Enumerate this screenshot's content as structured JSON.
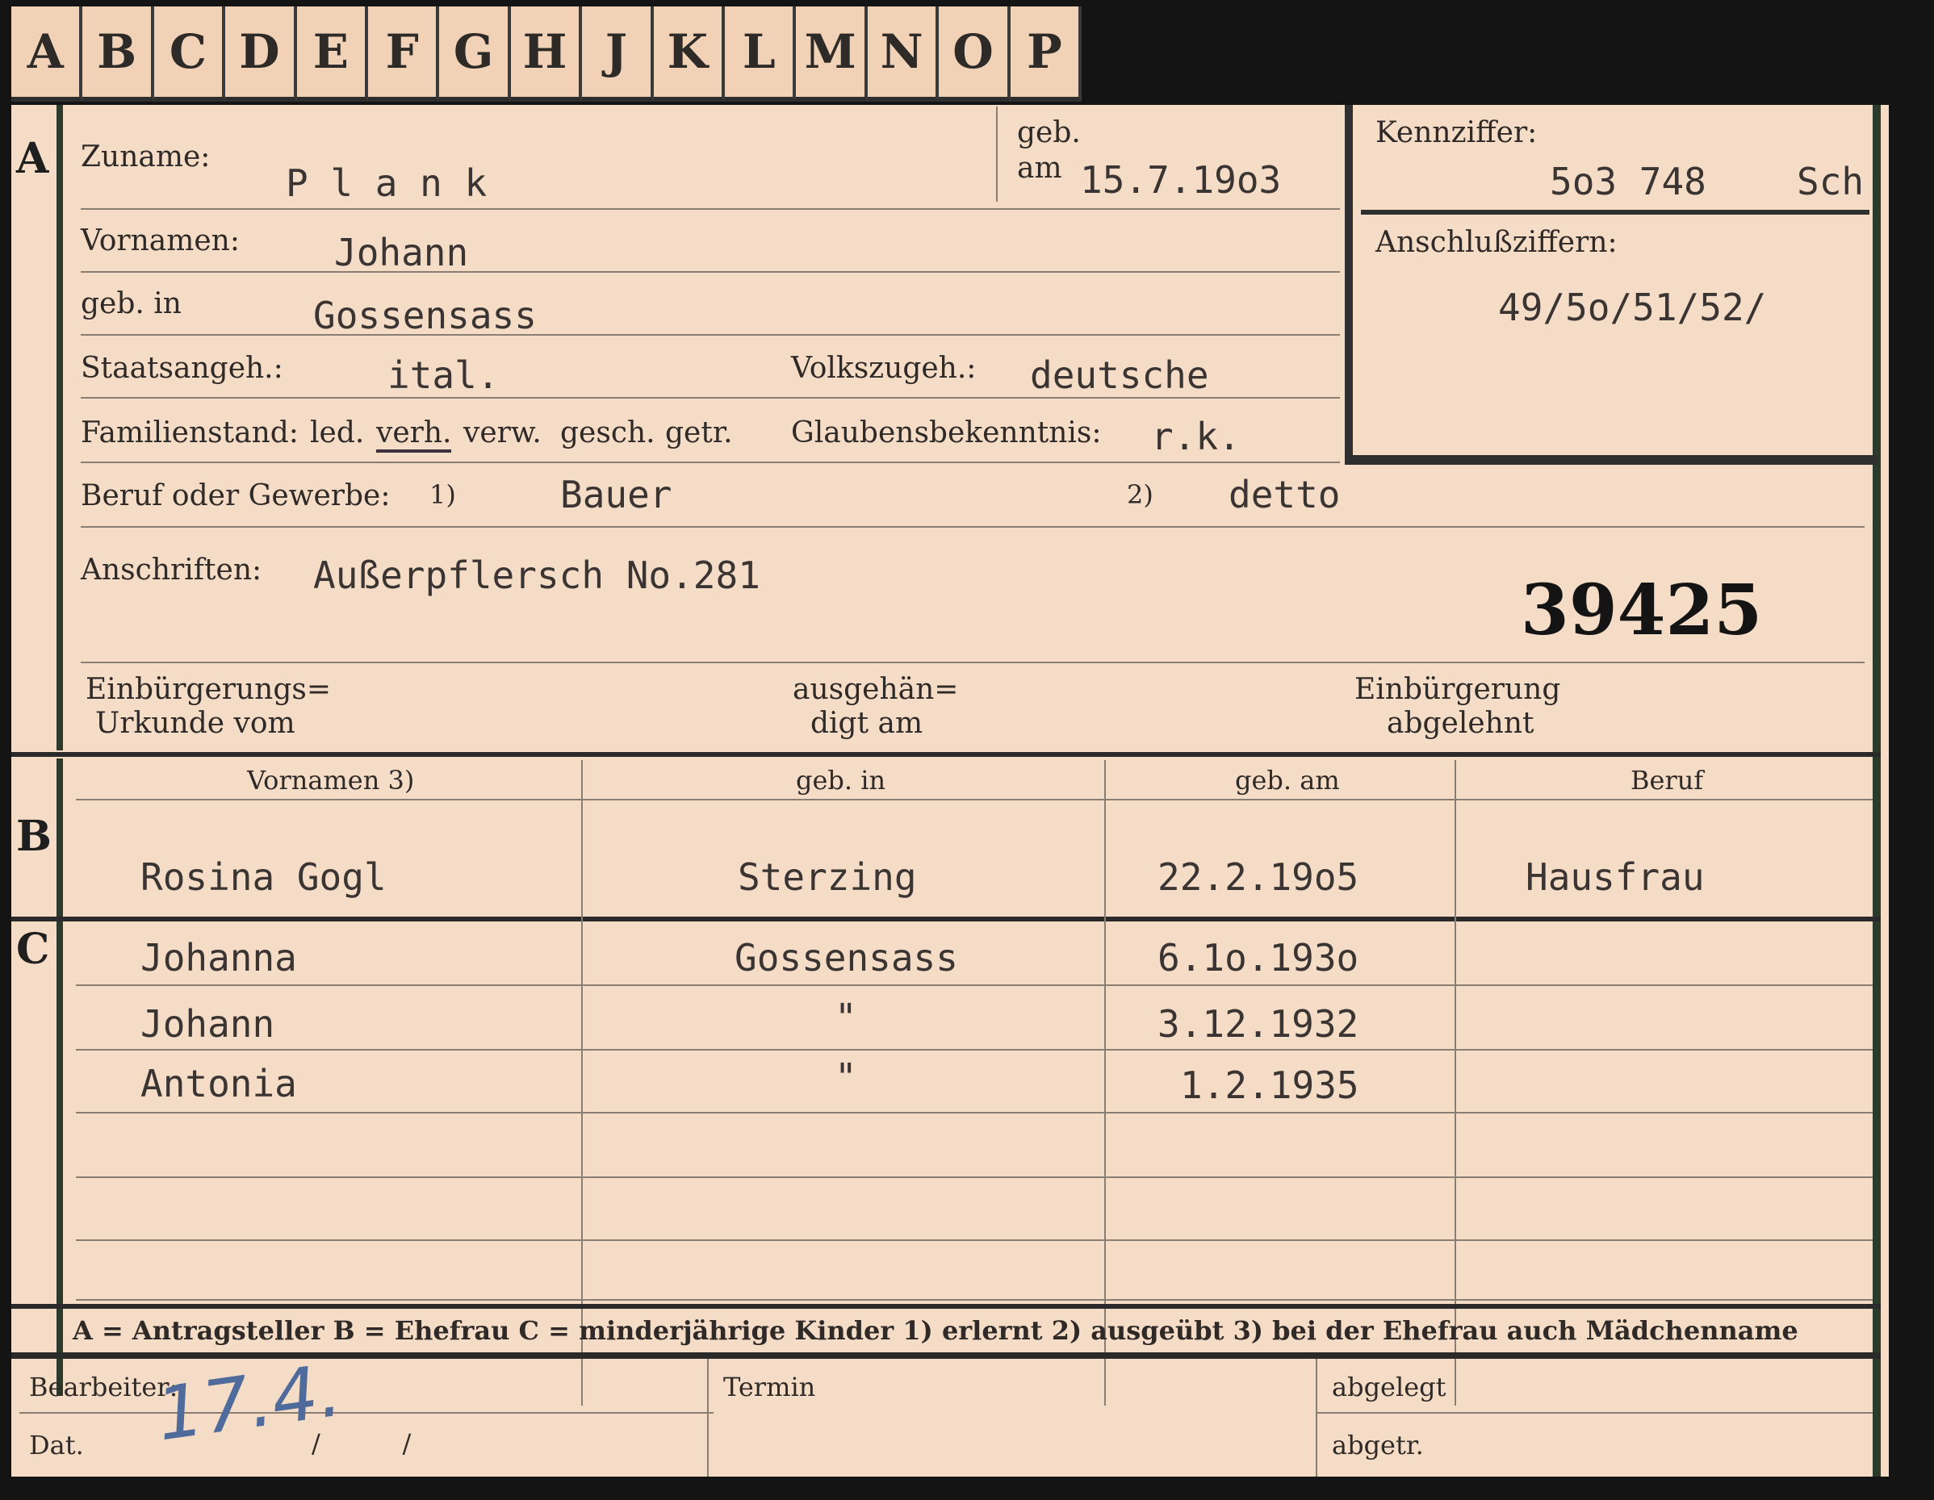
{
  "tabs": [
    "A",
    "B",
    "C",
    "D",
    "E",
    "F",
    "G",
    "H",
    "J",
    "K",
    "L",
    "M",
    "N",
    "O",
    "P"
  ],
  "section_a": {
    "marker": "A",
    "zuname_label": "Zuname:",
    "zuname": "P l a n k",
    "geb_label": "geb.",
    "am_label": "am",
    "geb_am": "15.7.19o3",
    "kennziffer_label": "Kennziffer:",
    "kennziffer": "5o3 748",
    "kennziffer_suffix": "Sch",
    "vornamen_label": "Vornamen:",
    "vornamen": "Johann",
    "anschluss_label": "Anschlußziffern:",
    "anschluss": "49/5o/51/52/",
    "geb_in_label": "geb. in",
    "geb_in": "Gossensass",
    "staatsangeh_label": "Staatsangeh.:",
    "staatsangeh": "ital.",
    "volkszugeh_label": "Volkszugeh.:",
    "volkszugeh": "deutsche",
    "familienstand_label": "Familienstand:",
    "familienstand_options": [
      "led.",
      "verh.",
      "verw.",
      "gesch.",
      "getr."
    ],
    "glaubens_label": "Glaubensbekenntnis:",
    "glaubens": "r.k.",
    "beruf_label": "Beruf oder Gewerbe:",
    "beruf_note1": "1)",
    "beruf1": "Bauer",
    "beruf_note2": "2)",
    "beruf2": "detto",
    "anschriften_label": "Anschriften:",
    "anschriften": "Außerpflersch No.281",
    "stamp_number": "39425",
    "einb_urkunde_label": "Einbürgerungs=",
    "einb_urkunde_label2": "Urkunde vom",
    "ausgehaend_label": "ausgehän=",
    "ausgehaend_label2": "digt am",
    "einb_abgelehnt_label": "Einbürgerung",
    "einb_abgelehnt_label2": "abgelehnt"
  },
  "section_b": {
    "marker": "B",
    "headers": [
      "Vornamen 3)",
      "geb. in",
      "geb. am",
      "Beruf"
    ],
    "row": [
      "Rosina  Gogl",
      "Sterzing",
      "22.2.19o5",
      "Hausfrau"
    ]
  },
  "section_c": {
    "marker": "C",
    "rows": [
      [
        "Johanna",
        "Gossensass",
        "6.1o.193o",
        ""
      ],
      [
        "Johann",
        "\"",
        "3.12.1932",
        ""
      ],
      [
        "Antonia",
        "\"",
        "1.2.1935",
        ""
      ]
    ]
  },
  "legend": "A = Antragsteller   B = Ehefrau   C = minderjährige Kinder   1) erlernt   2) ausgeübt   3) bei der Ehefrau auch Mädchenname",
  "footer": {
    "bearbeiter_label": "Bearbeiter:",
    "dat_label": "Dat.",
    "dat_slashes": "/          /",
    "termin_label": "Termin",
    "abgelegt_label": "abgelegt",
    "abgetr_label": "abgetr.",
    "signature": "17.4."
  },
  "colors": {
    "card": "#f5dcc6",
    "frame": "#141414",
    "ink": "#2a2522",
    "signature": "#4f6b9c"
  }
}
